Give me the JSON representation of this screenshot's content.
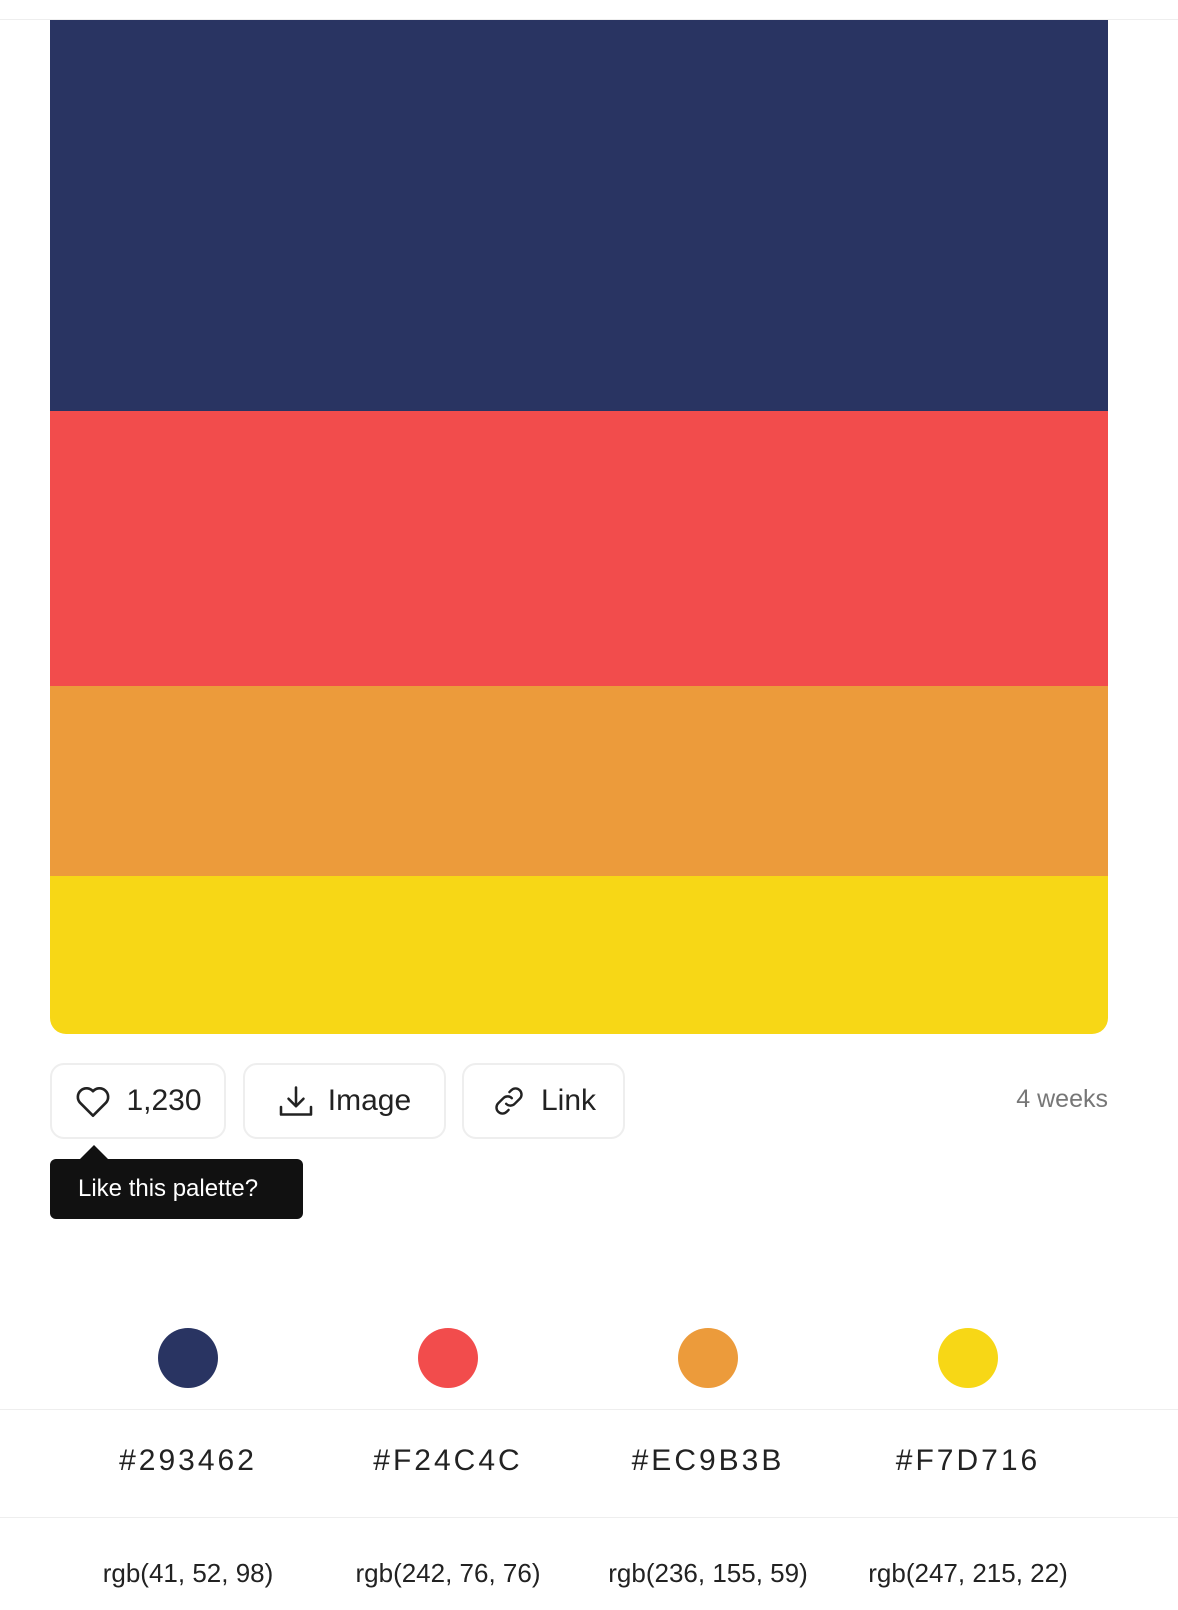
{
  "palette": {
    "colors": [
      "#293462",
      "#F24C4C",
      "#EC9B3B",
      "#F7D716"
    ]
  },
  "actions": {
    "like_count": "1,230",
    "image_label": "Image",
    "link_label": "Link",
    "time_ago": "4 weeks"
  },
  "tooltip": {
    "text": "Like this palette?"
  },
  "codes": {
    "hex": [
      "#293462",
      "#F24C4C",
      "#EC9B3B",
      "#F7D716"
    ],
    "rgb": [
      "rgb(41, 52, 98)",
      "rgb(242, 76, 76)",
      "rgb(236, 155, 59)",
      "rgb(247, 215, 22)"
    ]
  },
  "icons": {
    "like": "heart-icon",
    "image": "download-icon",
    "link": "link-icon"
  }
}
